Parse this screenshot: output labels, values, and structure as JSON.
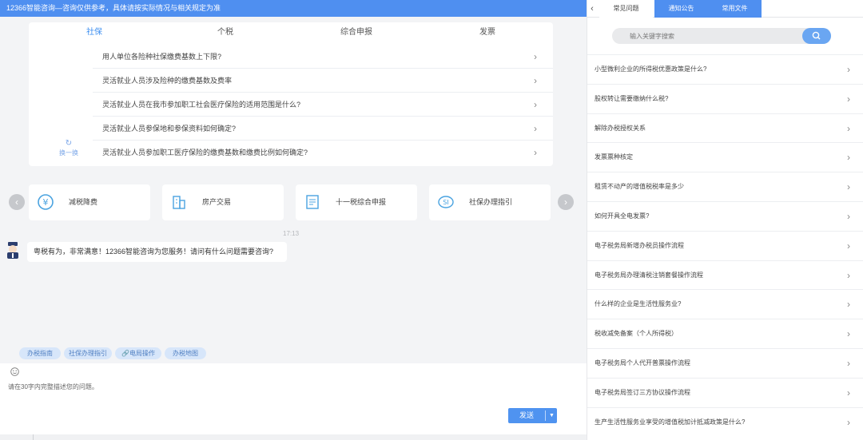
{
  "banner": {
    "text": "12366智能咨询—咨询仅供参考，具体请按实际情况与相关规定为准"
  },
  "faq": {
    "tabs": [
      "社保",
      "个税",
      "综合申报",
      "发票"
    ],
    "active_tab": 0,
    "refresh_label": "换一换",
    "questions": [
      "用人单位各险种社保缴费基数上下限?",
      "灵活就业人员涉及险种的缴费基数及费率",
      "灵活就业人员在我市参加职工社会医疗保险的适用范围是什么?",
      "灵活就业人员参保地和参保资料如何确定?",
      "灵活就业人员参加职工医疗保险的缴费基数和缴费比例如何确定?"
    ]
  },
  "quick_cards": [
    {
      "label": "减税降费",
      "icon": "tax-reduction-icon"
    },
    {
      "label": "房产交易",
      "icon": "building-icon"
    },
    {
      "label": "十一税综合申报",
      "icon": "form-icon"
    },
    {
      "label": "社保办理指引",
      "icon": "social-security-icon"
    }
  ],
  "chat": {
    "timestamp": "17:13",
    "greeting": "粤税有为，非常满意！12366智能咨询为您服务！请问有什么问题需要咨询?"
  },
  "chips": [
    "办税指南",
    "社保办理指引",
    "电局操作",
    "办税地图"
  ],
  "input": {
    "hint": "请在30字内完整描述您的问题。",
    "send_label": "发送"
  },
  "right_panel": {
    "tabs": [
      "常见问题",
      "通知公告",
      "常用文件"
    ],
    "active_tab": 0,
    "search_placeholder": "输入关键字搜索",
    "items": [
      "小型微利企业的所得税优惠政策是什么?",
      "股权转让需要缴纳什么税?",
      "解除办税授权关系",
      "发票票种核定",
      "租赁不动产的增值税税率是多少",
      "如何开具全电发票?",
      "电子税务局新增办税员操作流程",
      "电子税务局办理清税注销套餐操作流程",
      "什么样的企业是生活性服务业?",
      "税收减免备案（个人所得税）",
      "电子税务局个人代开普票操作流程",
      "电子税务局签订三方协议操作流程",
      "生产生活性服务业享受的增值税加计抵减政策是什么?"
    ]
  },
  "colors": {
    "accent": "#4f8ff0",
    "chip_bg": "#d7e6fa",
    "send": "#4f93f0"
  }
}
